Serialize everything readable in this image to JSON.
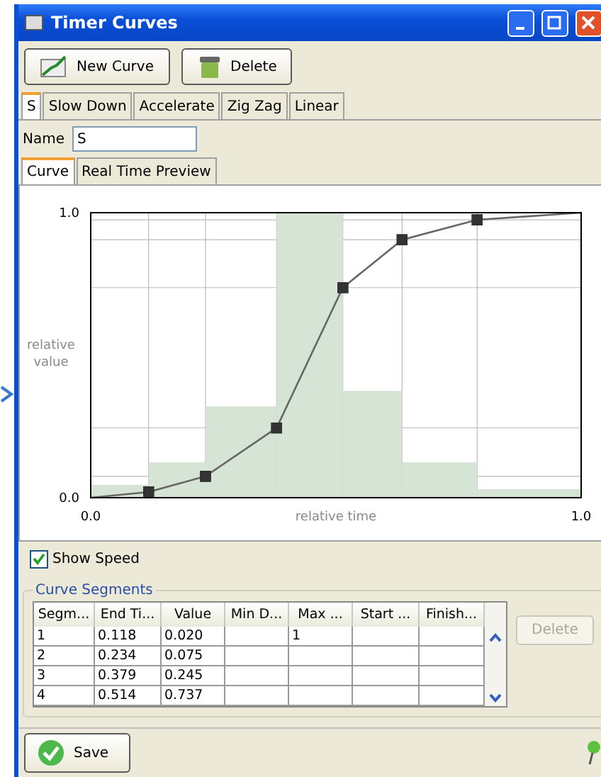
{
  "window": {
    "title": "Timer Curves"
  },
  "toolbar": [
    {
      "label": "New Curve",
      "kind": "chart"
    },
    {
      "label": "Delete",
      "kind": "bin"
    }
  ],
  "curve_tabs": [
    {
      "label": "S",
      "selected": true
    },
    {
      "label": "Slow Down",
      "selected": false
    },
    {
      "label": "Accelerate",
      "selected": false
    },
    {
      "label": "Zig Zag",
      "selected": false
    },
    {
      "label": "Linear",
      "selected": false
    }
  ],
  "name_field": {
    "label": "Name",
    "value": "S"
  },
  "view_tabs": [
    {
      "label": "Curve",
      "selected": true
    },
    {
      "label": "Real Time Preview",
      "selected": false
    }
  ],
  "chart": {
    "chart_data": {
      "type": "line",
      "xlabel": "relative time",
      "ylabel": "relative value",
      "xlim": [
        0,
        1
      ],
      "ylim": [
        0,
        1
      ],
      "xticks": [
        {
          "value": 0,
          "label": "0.0"
        },
        {
          "value": 1,
          "label": "1.0"
        }
      ],
      "yticks": [
        {
          "value": 0,
          "label": "0.0"
        },
        {
          "value": 1,
          "label": "1.0"
        }
      ],
      "x": [
        0,
        0.118,
        0.234,
        0.379,
        0.514,
        0.635,
        0.788,
        1
      ],
      "series": [
        {
          "type": "bar",
          "color": "#d6e4d6",
          "x": [
            0.059,
            0.176,
            0.3065,
            0.4465,
            0.5745,
            0.7115,
            0.894
          ],
          "values": [
            0.045,
            0.124,
            0.32,
            1,
            0.375,
            0.124,
            0.03
          ]
        },
        {
          "type": "line",
          "color": "#666666",
          "values": [
            0,
            0.02,
            0.075,
            0.245,
            0.737,
            0.905,
            0.975,
            1
          ]
        }
      ]
    }
  },
  "show_speed": {
    "label": "Show Speed",
    "checked": true
  },
  "segments": {
    "title": "Curve Segments",
    "columns": [
      "Segm...",
      "End Ti...",
      "Value",
      "Min D...",
      "Max ...",
      "Start ...",
      "Finish..."
    ],
    "rows": [
      [
        "1",
        "0.118",
        "0.020",
        "",
        "1",
        "",
        ""
      ],
      [
        "2",
        "0.234",
        "0.075",
        "",
        "",
        "",
        ""
      ],
      [
        "3",
        "0.379",
        "0.245",
        "",
        "",
        "",
        ""
      ],
      [
        "4",
        "0.514",
        "0.737",
        "",
        "",
        "",
        ""
      ]
    ],
    "delete": {
      "label": "Delete",
      "disabled": true
    }
  },
  "save": {
    "label": "Save"
  }
}
